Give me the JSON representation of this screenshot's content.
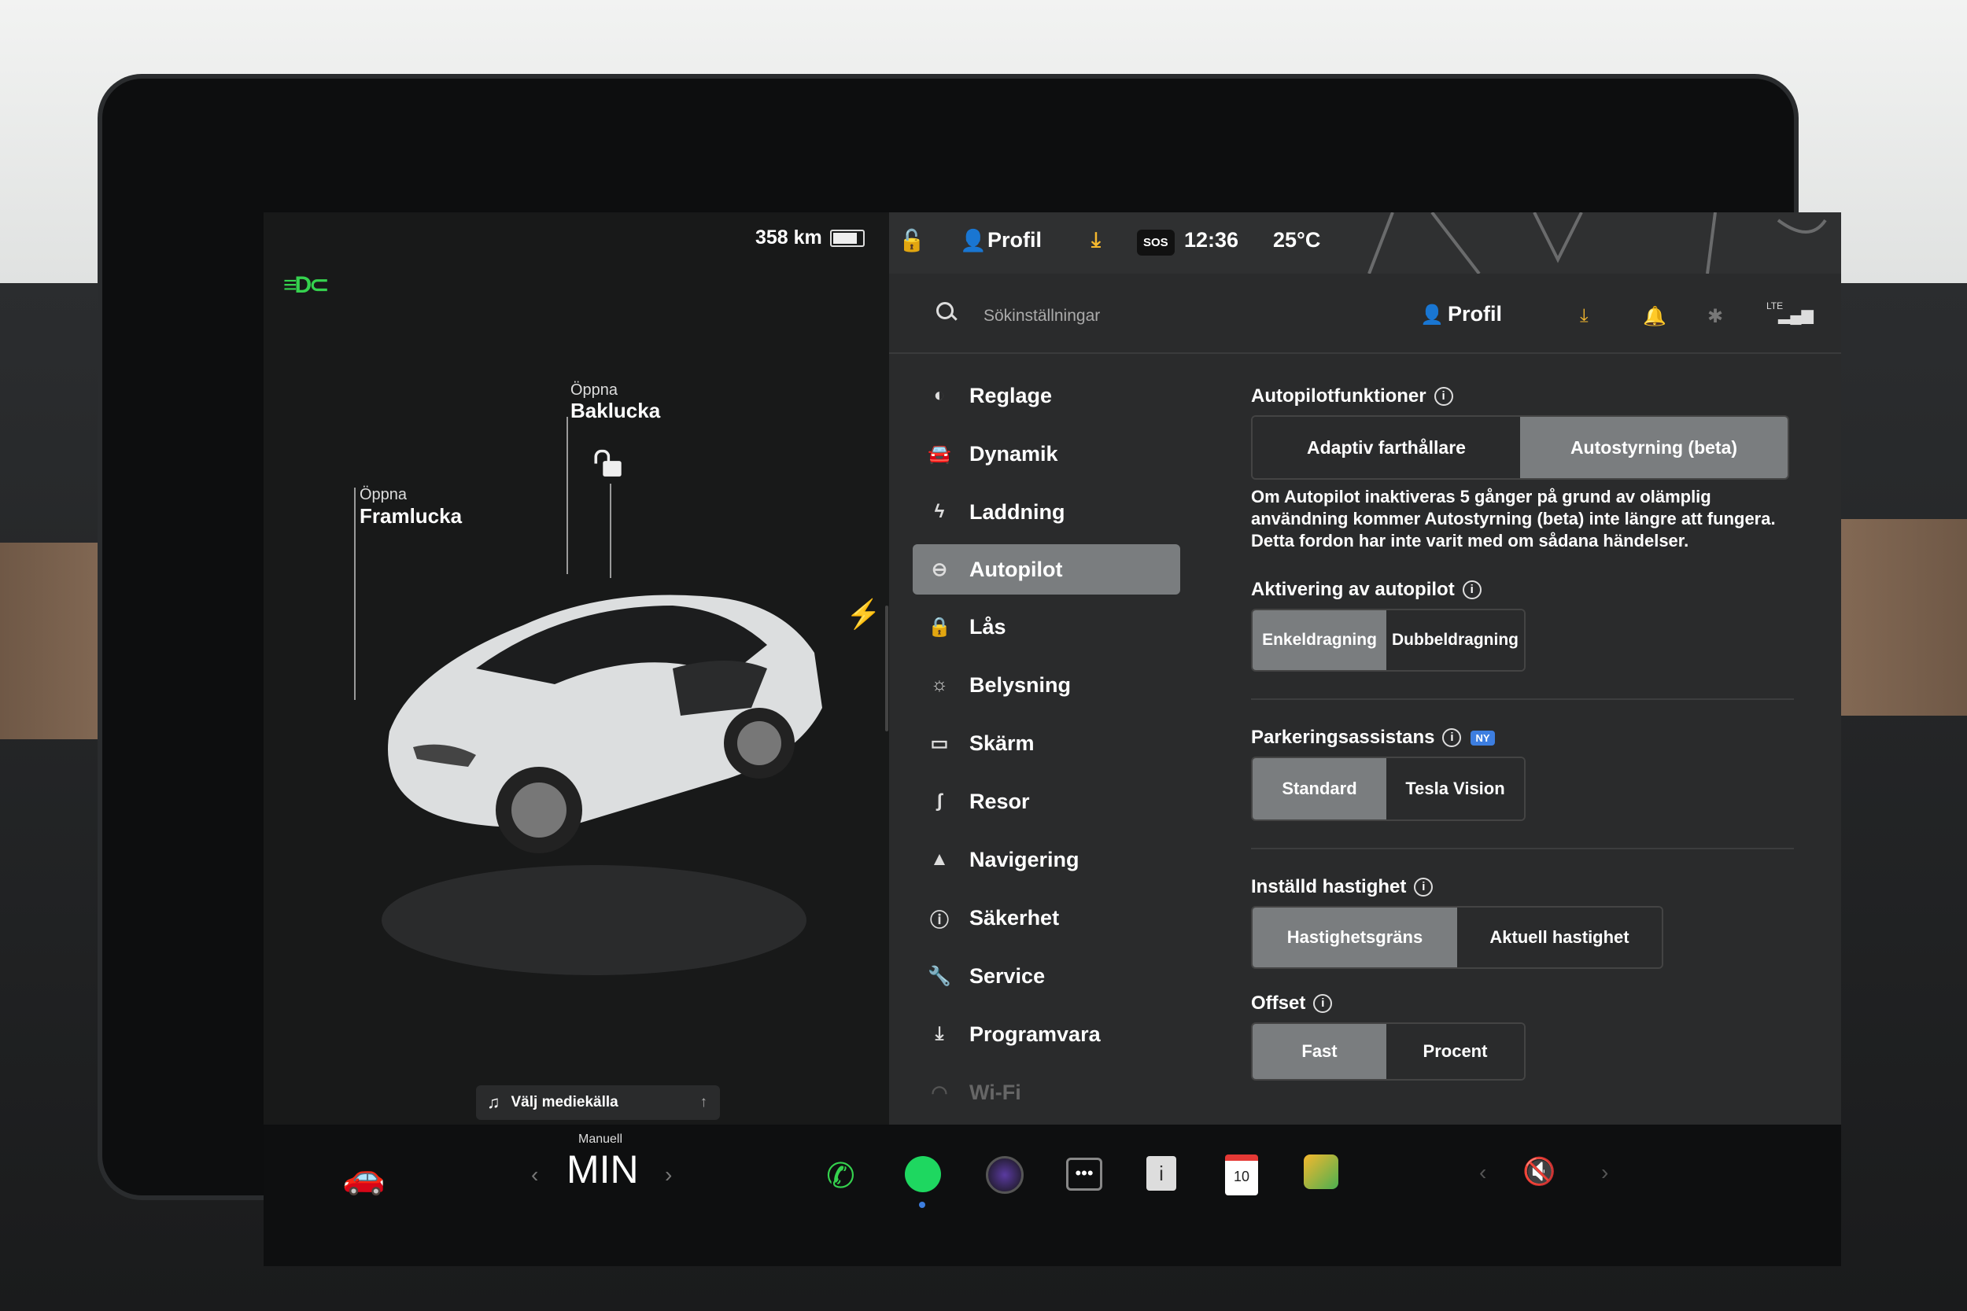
{
  "status_bar": {
    "range": "358 km",
    "profile": "Profil",
    "sos": "SOS",
    "time": "12:36",
    "temperature": "25°C"
  },
  "car_panel": {
    "front_trunk_small": "Öppna",
    "front_trunk_big": "Framlucka",
    "rear_trunk_small": "Öppna",
    "rear_trunk_big": "Baklucka",
    "media_source": "Välj mediekälla"
  },
  "header": {
    "search_placeholder": "Sökinställningar",
    "profile": "Profil",
    "lte": "LTE"
  },
  "nav": {
    "items": [
      {
        "label": "Reglage",
        "icon": "toggle-icon"
      },
      {
        "label": "Dynamik",
        "icon": "car-front-icon"
      },
      {
        "label": "Laddning",
        "icon": "bolt-icon"
      },
      {
        "label": "Autopilot",
        "icon": "steering-wheel-icon"
      },
      {
        "label": "Lås",
        "icon": "lock-icon"
      },
      {
        "label": "Belysning",
        "icon": "sun-icon"
      },
      {
        "label": "Skärm",
        "icon": "display-icon"
      },
      {
        "label": "Resor",
        "icon": "trips-icon"
      },
      {
        "label": "Navigering",
        "icon": "navigation-icon"
      },
      {
        "label": "Säkerhet",
        "icon": "safety-icon"
      },
      {
        "label": "Service",
        "icon": "wrench-icon"
      },
      {
        "label": "Programvara",
        "icon": "download-icon"
      },
      {
        "label": "Wi-Fi",
        "icon": "wifi-icon"
      }
    ],
    "active": "Autopilot"
  },
  "autopilot": {
    "features_title": "Autopilotfunktioner",
    "features_opt1": "Adaptiv farthållare",
    "features_opt2": "Autostyrning (beta)",
    "features_selected": "Autostyrning (beta)",
    "description": "Om Autopilot inaktiveras 5 gånger på grund av olämplig användning kommer Autostyrning (beta) inte längre att fungera. Detta fordon har inte varit med om sådana händelser.",
    "activation_title": "Aktivering av autopilot",
    "activation_opt1": "Enkeldragning",
    "activation_opt2": "Dubbeldragning",
    "activation_selected": "Enkeldragning",
    "parking_title": "Parkeringsassistans",
    "parking_badge": "NY",
    "parking_opt1": "Standard",
    "parking_opt2": "Tesla Vision",
    "parking_selected": "Standard",
    "speed_title": "Inställd hastighet",
    "speed_opt1": "Hastighetsgräns",
    "speed_opt2": "Aktuell hastighet",
    "speed_selected": "Hastighetsgräns",
    "offset_title": "Offset",
    "offset_opt1": "Fast",
    "offset_opt2": "Procent",
    "offset_selected": "Fast"
  },
  "dock": {
    "gear_label": "Manuell",
    "gear_value": "MIN",
    "calendar_day": "10"
  },
  "colors": {
    "accent_green": "#35d24e",
    "download_yellow": "#f5b82e",
    "selected_grey": "#7a7d7f"
  }
}
